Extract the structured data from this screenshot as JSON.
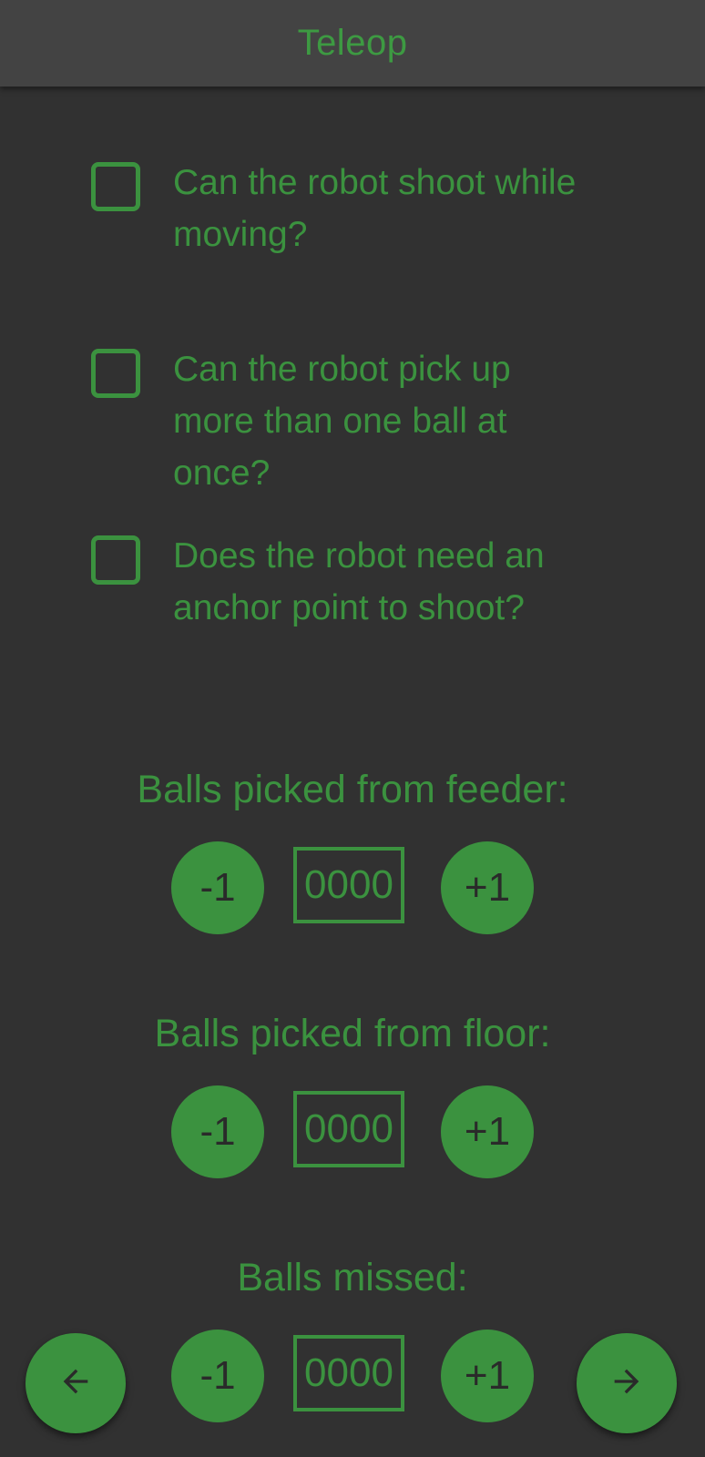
{
  "header": {
    "title": "Teleop"
  },
  "questions": [
    {
      "label": "Can the robot shoot while moving?",
      "checked": false
    },
    {
      "label": "Can the robot pick up more than one ball at once?",
      "checked": false
    },
    {
      "label": "Does the robot need an anchor point to shoot?",
      "checked": false
    }
  ],
  "counters": [
    {
      "title": "Balls picked from feeder:",
      "minus_label": "-1",
      "value": "0000",
      "plus_label": "+1"
    },
    {
      "title": "Balls picked from floor:",
      "minus_label": "-1",
      "value": "0000",
      "plus_label": "+1"
    },
    {
      "title": "Balls missed:",
      "minus_label": "-1",
      "value": "0000",
      "plus_label": "+1"
    }
  ],
  "nav": {
    "back_icon": "arrow-left-icon",
    "forward_icon": "arrow-right-icon"
  },
  "colors": {
    "accent": "#3b923f",
    "background": "#313131",
    "header": "#434343"
  }
}
